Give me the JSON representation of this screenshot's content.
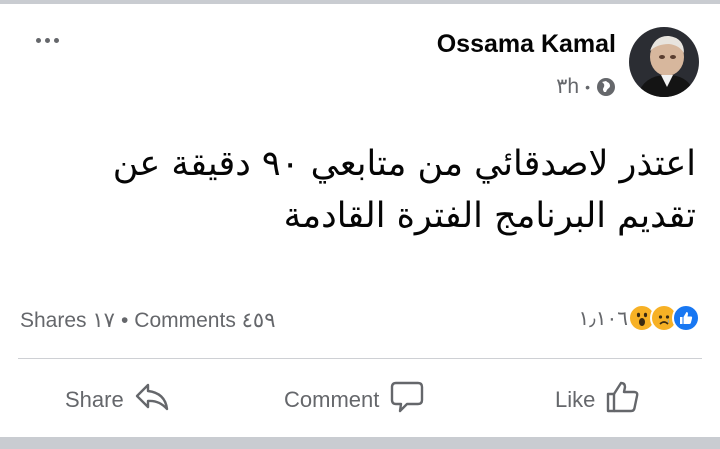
{
  "post": {
    "author": "Ossama Kamal",
    "time": "٣h",
    "separator": "•",
    "text_line1": "اعتذر لاصدقائي من متابعي ٩٠ دقيقة عن",
    "text_line2": "تقديم البرنامج الفترة القادمة"
  },
  "stats": {
    "shares": "Shares ١٧",
    "separator": "•",
    "comments": "Comments ٤٥٩",
    "reactions_count": "١٫١٠٦",
    "reaction_icons": [
      "like-icon",
      "sad-icon",
      "wow-icon"
    ]
  },
  "actions": {
    "share": "Share",
    "comment": "Comment",
    "like": "Like"
  },
  "colors": {
    "like_blue": "#1877f2",
    "emoji_yellow": "#f7b125",
    "secondary_text": "#65676b"
  }
}
